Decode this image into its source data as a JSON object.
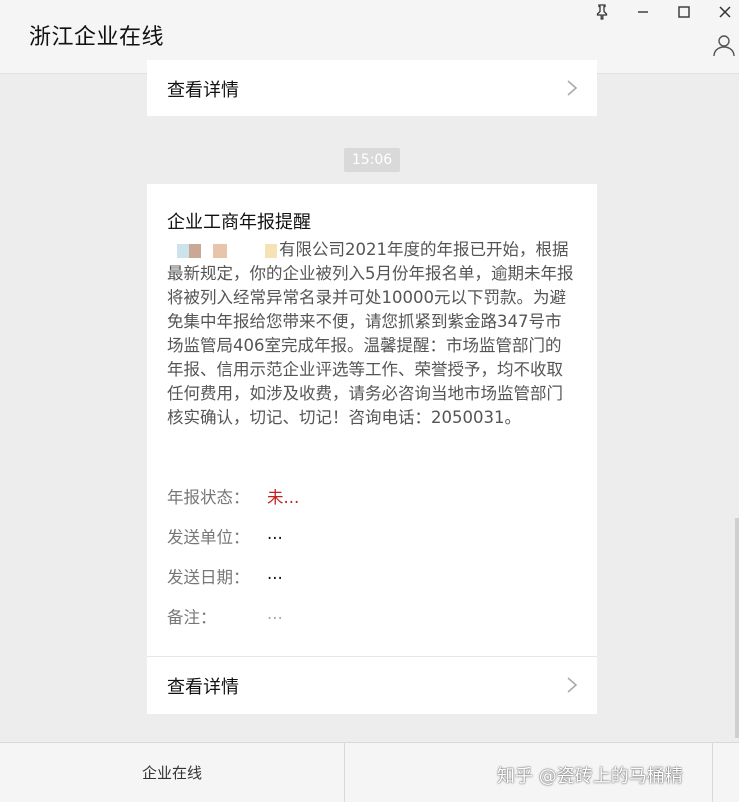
{
  "window": {
    "title": "浙江企业在线"
  },
  "top_card": {
    "detail_label": "查看详情"
  },
  "timestamp": "15:06",
  "message": {
    "title": "企业工商年报提醒",
    "body_visible": "有限公司2021年度的年报已开始，根据最新规定，你的企业被列入5月份年报名单，逾期未年报将被列入经常异常名录并可处10000元以下罚款。为避免集中年报给您带来不便，请您抓紧到紫金路347号市场监管局406室完成年报。温馨提醒：市场监管部门的年报、信用示范企业评选等工作、荣誉授予，均不收取任何费用，如涉及收费，请务必咨询当地市场监管部门核实确认，切记、切记！咨询电话：2050031。",
    "fields": [
      {
        "label": "年报状态：",
        "value": "未..."
      },
      {
        "label": "发送单位：",
        "value": "..."
      },
      {
        "label": "发送日期：",
        "value": "..."
      },
      {
        "label": "备注：",
        "value": "..."
      }
    ],
    "detail_label": "查看详情"
  },
  "bottom_menu": {
    "item1": "企业在线"
  },
  "watermark": "知乎 @瓷砖上的马桶精",
  "colors": {
    "background": "#ededed",
    "card": "#ffffff",
    "status_red": "#c81e1e"
  }
}
